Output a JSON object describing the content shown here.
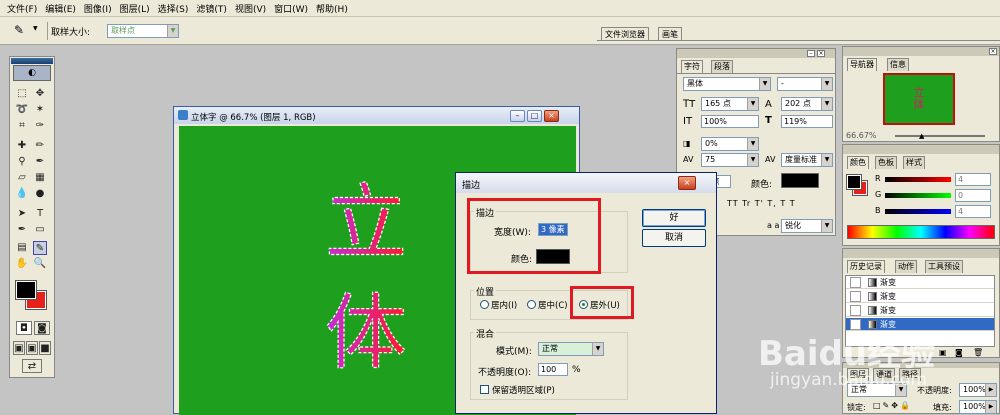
{
  "menubar": {
    "items": [
      "文件(F)",
      "编辑(E)",
      "图像(I)",
      "图层(L)",
      "选择(S)",
      "滤镜(T)",
      "视图(V)",
      "窗口(W)",
      "帮助(H)"
    ]
  },
  "options": {
    "sample_label": "取样大小:",
    "sample_value": "取样点",
    "tab_browser": "文件浏览器",
    "tab_brush": "画笔"
  },
  "document": {
    "title": "立体字 @ 66.7% (图层 1, RGB)",
    "char1": "立",
    "char2": "体",
    "bg": "#1ea01e"
  },
  "stroke_dialog": {
    "title": "描边",
    "stroke_group": "描边",
    "width_label": "宽度(W):",
    "width_value": "3 像素",
    "color_label": "颜色:",
    "ok": "好",
    "cancel": "取消",
    "position_group": "位置",
    "inside": "居内(I)",
    "center": "居中(C)",
    "outside": "居外(U)",
    "blend_group": "混合",
    "mode_label": "模式(M):",
    "mode_value": "正常",
    "opacity_label": "不透明度(O):",
    "opacity_value": "100",
    "opacity_unit": "%",
    "preserve_label": "保留透明区域(P)"
  },
  "char_panel": {
    "tab_char": "字符",
    "tab_para": "段落",
    "font": "黑体",
    "style": "-",
    "size": "165 点",
    "leading": "202 点",
    "vscale": "100%",
    "hscale": "119%",
    "tracking": "0%",
    "kerning": "75",
    "kern_mode": "度量标准",
    "baseline": "0 点",
    "color_label": "颜色:",
    "styles": "TT Tr T' T, T T",
    "aa_label": "a a",
    "aa_value": "锐化"
  },
  "navigator": {
    "tab_nav": "导航器",
    "tab_info": "信息",
    "zoom": "66.67%",
    "thumb_text": "立体"
  },
  "color_panel": {
    "tab_color": "颜色",
    "tab_swatches": "色板",
    "tab_styles": "样式",
    "r_label": "R",
    "g_label": "G",
    "b_label": "B",
    "r": "4",
    "g": "0",
    "b": "4"
  },
  "history": {
    "tab_history": "历史记录",
    "tab_actions": "动作",
    "tab_presets": "工具预设",
    "items": [
      "渐变",
      "渐变",
      "渐变",
      "渐变"
    ]
  },
  "layers": {
    "tab_layers": "图层",
    "tab_channels": "通道",
    "tab_paths": "路径",
    "blend": "正常",
    "opacity_label": "不透明度:",
    "opacity": "100%",
    "lock_label": "锁定:",
    "fill_label": "填充:",
    "fill": "100%"
  },
  "watermark": {
    "brand": "Baidu经验",
    "url": "jingyan.baidu.com"
  }
}
